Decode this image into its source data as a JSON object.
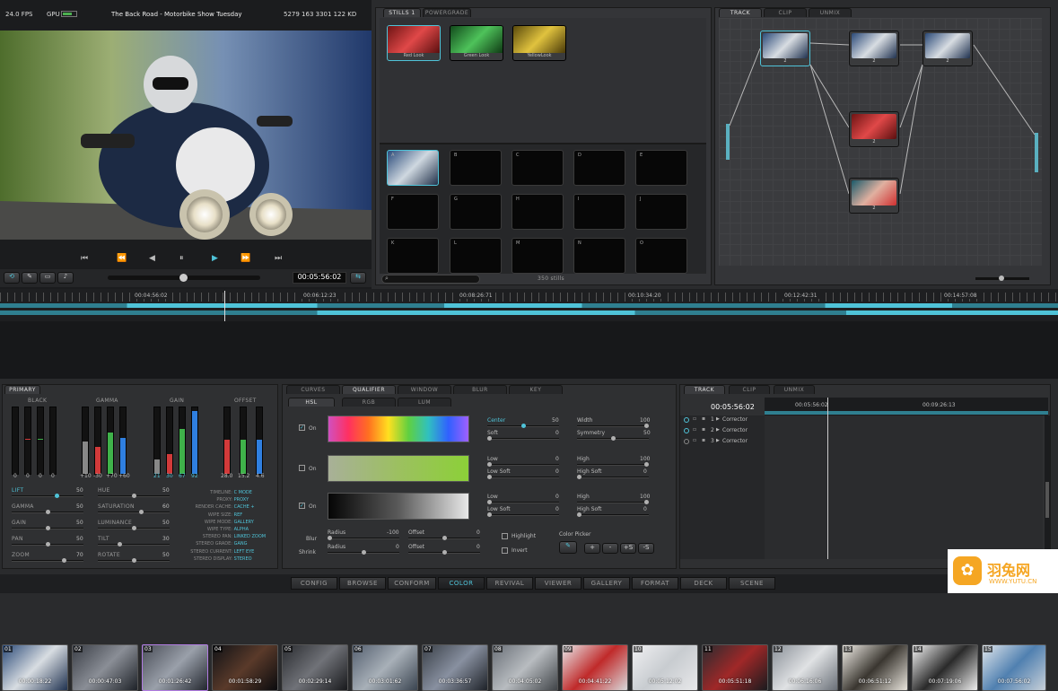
{
  "viewer": {
    "fps": "24.0 FPS",
    "gpu": "GPU",
    "title": "The Back Road - Motorbike Show Tuesday",
    "stats": "5279 163 3301 122 KD",
    "timecode": "00:05:56:02"
  },
  "stills": {
    "tabs": [
      "STILLS 1",
      "POWERGRADE"
    ],
    "looks": [
      "Red Look",
      "Green Look",
      "YellowLook"
    ],
    "slots": [
      "A",
      "B",
      "C",
      "D",
      "E",
      "F",
      "G",
      "H",
      "I",
      "J",
      "K",
      "L",
      "M",
      "N",
      "O"
    ],
    "count": "350 stills"
  },
  "nodes": {
    "tabs": [
      "TRACK",
      "CLIP",
      "UNMIX"
    ],
    "labels": [
      "2",
      "2",
      "2",
      "2",
      "2"
    ]
  },
  "timeline": {
    "ticks": [
      "00:04:56:02",
      "00:06:12:23",
      "00:08:26:71",
      "00:10:34:20",
      "00:12:42:31",
      "00:14:57:08"
    ],
    "clips": [
      {
        "n": "01",
        "tc": "00:00:18:22"
      },
      {
        "n": "02",
        "tc": "00:00:47:03"
      },
      {
        "n": "03",
        "tc": "00:01:26:42"
      },
      {
        "n": "04",
        "tc": "00:01:58:29"
      },
      {
        "n": "05",
        "tc": "00:02:29:14"
      },
      {
        "n": "06",
        "tc": "00:03:01:62"
      },
      {
        "n": "07",
        "tc": "00:03:36:57"
      },
      {
        "n": "08",
        "tc": "00:04:05:02"
      },
      {
        "n": "09",
        "tc": "00:04:41:22"
      },
      {
        "n": "10",
        "tc": "00:05:12:02"
      },
      {
        "n": "11",
        "tc": "00:05:51:18"
      },
      {
        "n": "12",
        "tc": "00:06:16:06"
      },
      {
        "n": "13",
        "tc": "00:06:51:12"
      },
      {
        "n": "14",
        "tc": "00:07:19:06"
      },
      {
        "n": "15",
        "tc": "00:07:56:02"
      }
    ]
  },
  "primary": {
    "tab": "PRIMARY",
    "groups": [
      "BLACK",
      "GAMMA",
      "GAIN",
      "OFFSET"
    ],
    "black_vals": [
      "0",
      "0",
      "0",
      "0"
    ],
    "gamma_vals": [
      "+10",
      "-30",
      "+70",
      "+60"
    ],
    "gain_vals": [
      "21",
      "30",
      "67",
      "92"
    ],
    "offset_vals": [
      "28.0",
      "15.2",
      "4.6"
    ],
    "left_params": [
      {
        "label": "LIFT",
        "value": "50"
      },
      {
        "label": "GAMMA",
        "value": "50"
      },
      {
        "label": "GAIN",
        "value": "50"
      },
      {
        "label": "PAN",
        "value": "50"
      },
      {
        "label": "ZOOM",
        "value": "70"
      }
    ],
    "mid_params": [
      {
        "label": "HUE",
        "value": "50"
      },
      {
        "label": "SATURATION",
        "value": "60"
      },
      {
        "label": "LUMINANCE",
        "value": "50"
      },
      {
        "label": "TILT",
        "value": "30"
      },
      {
        "label": "ROTATE",
        "value": "50"
      }
    ],
    "info": [
      {
        "k": "TIMELINE:",
        "v": "C MODE"
      },
      {
        "k": "PROXY:",
        "v": "PROXY"
      },
      {
        "k": "RENDER CACHE:",
        "v": "CACHE +"
      },
      {
        "k": "WIPE SIZE:",
        "v": "REF"
      },
      {
        "k": "WIPE MODE:",
        "v": "GALLERY"
      },
      {
        "k": "WIPE TYPE:",
        "v": "ALPHA"
      },
      {
        "k": "STEREO PAN:",
        "v": "LINKED ZOOM"
      },
      {
        "k": "STEREO GRADE:",
        "v": "GANG"
      },
      {
        "k": "STEREO CURRENT:",
        "v": "LEFT EYE"
      },
      {
        "k": "STEREO DISPLAY:",
        "v": "STEREO"
      }
    ]
  },
  "qualifier": {
    "tabs": [
      "CURVES",
      "QUALIFIER",
      "WINDOW",
      "BLUR",
      "KEY"
    ],
    "subtabs": [
      "HSL",
      "RGB",
      "LUM"
    ],
    "rows": [
      {
        "on": "On",
        "checked": true,
        "p1": "Center",
        "v1": "50",
        "p2": "Soft",
        "v2": "0",
        "p3": "Width",
        "v3": "100",
        "p4": "Symmetry",
        "v4": "50"
      },
      {
        "on": "On",
        "checked": false,
        "p1": "Low",
        "v1": "0",
        "p2": "Low Soft",
        "v2": "0",
        "p3": "High",
        "v3": "100",
        "p4": "High Soft",
        "v4": "0"
      },
      {
        "on": "On",
        "checked": true,
        "p1": "Low",
        "v1": "0",
        "p2": "Low Soft",
        "v2": "0",
        "p3": "High",
        "v3": "100",
        "p4": "High Soft",
        "v4": "0"
      }
    ],
    "blur": "Blur",
    "shrink": "Shrink",
    "radius": "Radius",
    "radius1": "-100",
    "radius2": "0",
    "offset": "Offset",
    "offset1": "0",
    "offset2": "0",
    "highlight": "Highlight",
    "invert": "Invert",
    "picker": "Color Picker",
    "picker_btns": [
      "+",
      "-",
      "+S",
      "-S"
    ]
  },
  "track": {
    "tabs": [
      "TRACK",
      "CLIP",
      "UNMIX"
    ],
    "timecode": "00:05:56:02",
    "tc1": "00:05:56:02",
    "tc2": "00:09:26:13",
    "rows": [
      {
        "n": "1",
        "label": "Corrector"
      },
      {
        "n": "2",
        "label": "Corrector"
      },
      {
        "n": "3",
        "label": "Corrector"
      }
    ]
  },
  "pages": [
    "CONFIG",
    "BROWSE",
    "CONFORM",
    "COLOR",
    "REVIVAL",
    "VIEWER",
    "GALLERY",
    "FORMAT",
    "DECK",
    "SCENE"
  ],
  "watermark": {
    "brand": "羽兔网",
    "url": "WWW.YUTU.CN"
  },
  "colors": {
    "accent": "#4fc3d8",
    "red": "#d23a3a",
    "green": "#3fb24a",
    "blue": "#2f7fe0"
  }
}
